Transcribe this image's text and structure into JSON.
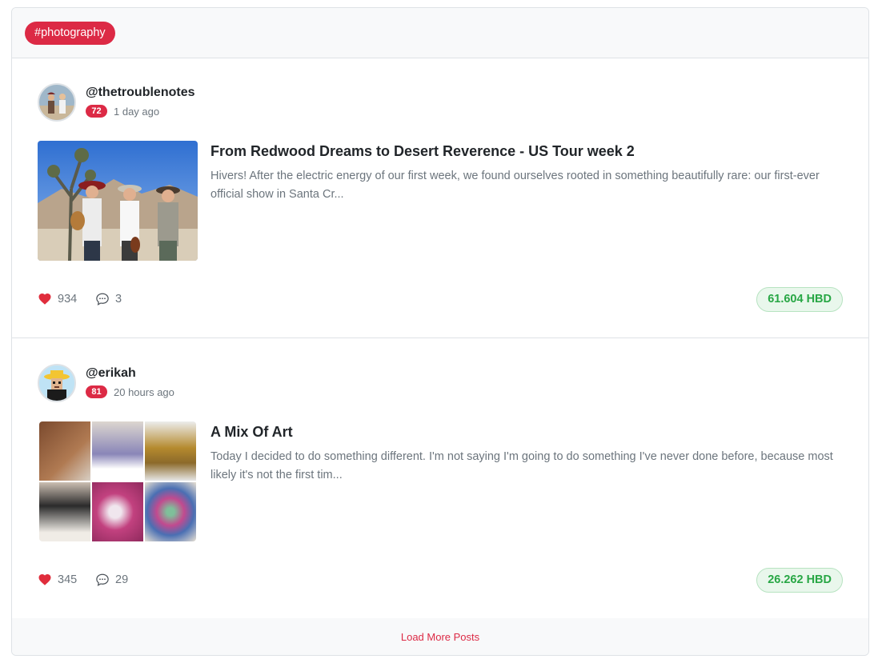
{
  "header": {
    "tag_label": "#photography"
  },
  "posts": [
    {
      "author": "@thetroublenotes",
      "reputation": "72",
      "time_ago": "1 day ago",
      "title": "From Redwood Dreams to Desert Reverence - US Tour week 2",
      "excerpt": "Hivers! After the electric energy of our first week, we found ourselves rooted in something beautifully rare: our first-ever official show in Santa Cr...",
      "likes": "934",
      "comments": "3",
      "payout": "61.604 HBD"
    },
    {
      "author": "@erikah",
      "reputation": "81",
      "time_ago": "20 hours ago",
      "title": "A Mix Of Art",
      "excerpt": "Today I decided to do something different. I'm not saying I'm going to do something I've never done before, because most likely it's not the first tim...",
      "likes": "345",
      "comments": "29",
      "payout": "26.262 HBD"
    }
  ],
  "footer": {
    "load_more_label": "Load More Posts"
  },
  "colors": {
    "accent": "#dc2a45",
    "payout_text": "#28a745",
    "payout_bg": "#e9f7ec"
  },
  "icons": {
    "like": "heart-icon",
    "comment": "speech-bubble-icon"
  }
}
